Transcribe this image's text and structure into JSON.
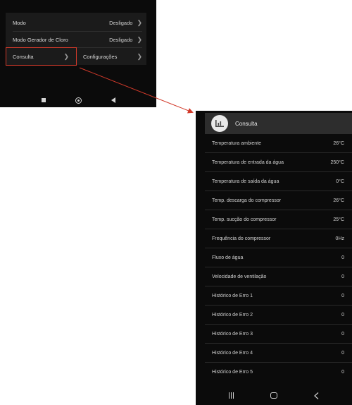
{
  "colors": {
    "screen_bg": "#0b0b0b",
    "panel_bg": "#1b1b1b",
    "header_bg": "#2d2d2d",
    "text": "#d2d2d2",
    "highlight": "#d23a2a"
  },
  "settings_screen": {
    "rows": [
      {
        "label": "Modo",
        "value": "Desligado"
      },
      {
        "label": "Modo Gerador de Cloro",
        "value": "Desligado"
      }
    ],
    "consulta_label": "Consulta",
    "configuracoes_label": "Configurações",
    "nav_icons": [
      "stop-square-icon",
      "home-circle-icon",
      "back-triangle-icon"
    ]
  },
  "consulta_screen": {
    "title": "Consulta",
    "header_icon": "chart-icon",
    "rows": [
      {
        "label": "Temperatura ambiente",
        "value": "26°C"
      },
      {
        "label": "Temperatura de entrada da água",
        "value": "250°C"
      },
      {
        "label": "Temperatura de saída da água",
        "value": "0°C"
      },
      {
        "label": "Temp. descarga do compressor",
        "value": "26°C"
      },
      {
        "label": "Temp. sucção do compressor",
        "value": "25°C"
      },
      {
        "label": "Frequência do compressor",
        "value": "0Hz"
      },
      {
        "label": "Fluxo de água",
        "value": "0"
      },
      {
        "label": "Velocidade de ventilação",
        "value": "0"
      },
      {
        "label": "Histórico de Erro 1",
        "value": "0"
      },
      {
        "label": "Histórico de Erro 2",
        "value": "0"
      },
      {
        "label": "Histórico de Erro 3",
        "value": "0"
      },
      {
        "label": "Histórico de Erro 4",
        "value": "0"
      },
      {
        "label": "Histórico de Erro 5",
        "value": "0"
      }
    ],
    "nav_icons": [
      "recents-icon",
      "home-icon",
      "back-chevron-icon"
    ]
  }
}
